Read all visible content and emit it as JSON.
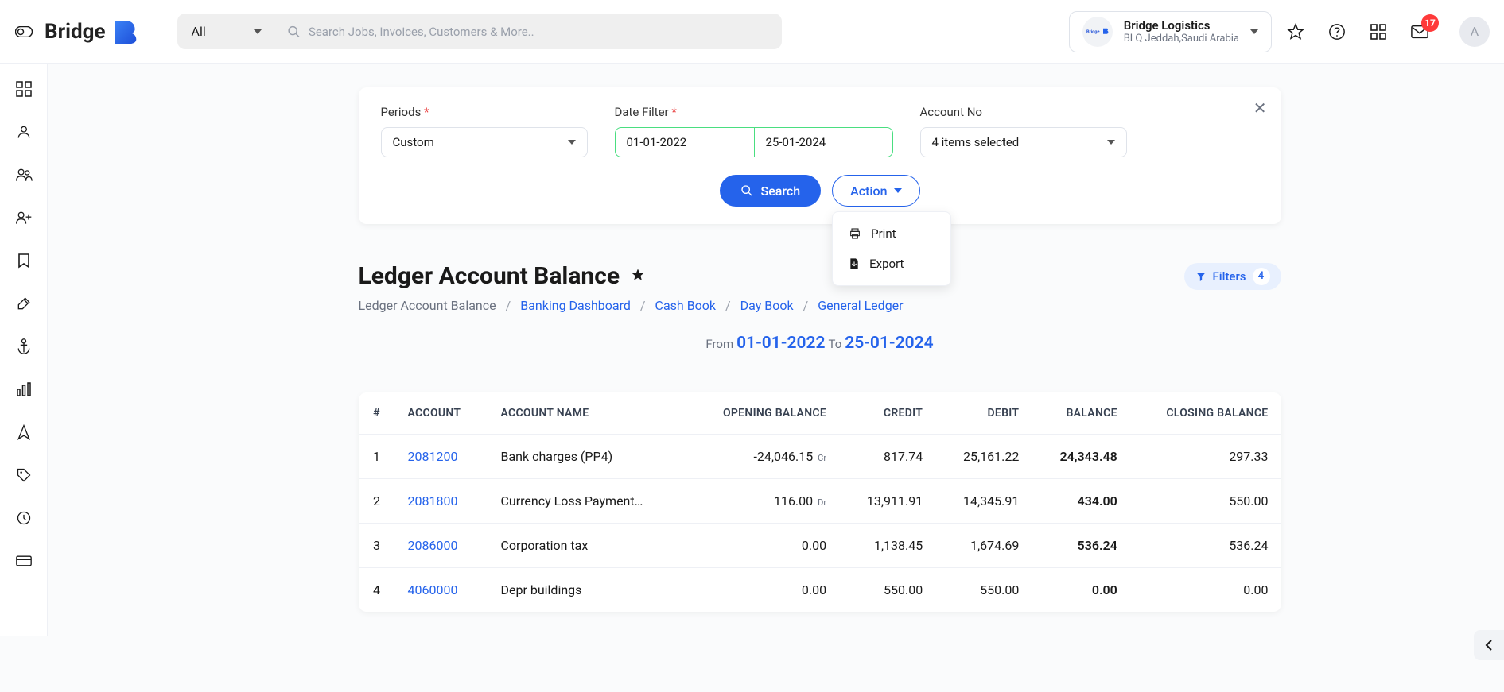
{
  "topbar": {
    "search_type": "All",
    "search_placeholder": "Search Jobs, Invoices, Customers & More..",
    "org": {
      "name": "Bridge Logistics",
      "sub": "BLQ Jeddah,Saudi Arabia"
    },
    "notif_count": "17",
    "profile_letter": "A",
    "logo_text": "Bridge"
  },
  "filter": {
    "periods_label": "Periods",
    "periods_value": "Custom",
    "date_label": "Date Filter",
    "date_from": "01-01-2022",
    "date_to": "25-01-2024",
    "account_label": "Account No",
    "account_value": "4 items selected",
    "search_btn": "Search",
    "action_btn": "Action",
    "action_menu": {
      "print": "Print",
      "export": "Export"
    }
  },
  "page": {
    "title": "Ledger Account Balance",
    "filters_chip": "Filters",
    "filters_count": "4",
    "crumbs": {
      "current": "Ledger Account Balance",
      "c1": "Banking Dashboard",
      "c2": "Cash Book",
      "c3": "Day Book",
      "c4": "General Ledger"
    },
    "range_from_label": "From",
    "range_to_label": "To",
    "range_from": "01-01-2022",
    "range_to": "25-01-2024"
  },
  "table": {
    "headers": {
      "idx": "#",
      "account": "ACCOUNT",
      "name": "ACCOUNT NAME",
      "opening": "OPENING BALANCE",
      "credit": "CREDIT",
      "debit": "DEBIT",
      "balance": "BALANCE",
      "closing": "CLOSING BALANCE"
    },
    "rows": [
      {
        "idx": "1",
        "account": "2081200",
        "name": "Bank charges (PP4)",
        "opening": "-24,046.15",
        "opening_sub": "Cr",
        "credit": "817.74",
        "debit": "25,161.22",
        "balance": "24,343.48",
        "closing": "297.33"
      },
      {
        "idx": "2",
        "account": "2081800",
        "name": "Currency Loss Payment…",
        "opening": "116.00",
        "opening_sub": "Dr",
        "credit": "13,911.91",
        "debit": "14,345.91",
        "balance": "434.00",
        "closing": "550.00"
      },
      {
        "idx": "3",
        "account": "2086000",
        "name": "Corporation tax",
        "opening": "0.00",
        "opening_sub": "",
        "credit": "1,138.45",
        "debit": "1,674.69",
        "balance": "536.24",
        "closing": "536.24"
      },
      {
        "idx": "4",
        "account": "4060000",
        "name": "Depr buildings",
        "opening": "0.00",
        "opening_sub": "",
        "credit": "550.00",
        "debit": "550.00",
        "balance": "0.00",
        "closing": "0.00"
      }
    ]
  }
}
